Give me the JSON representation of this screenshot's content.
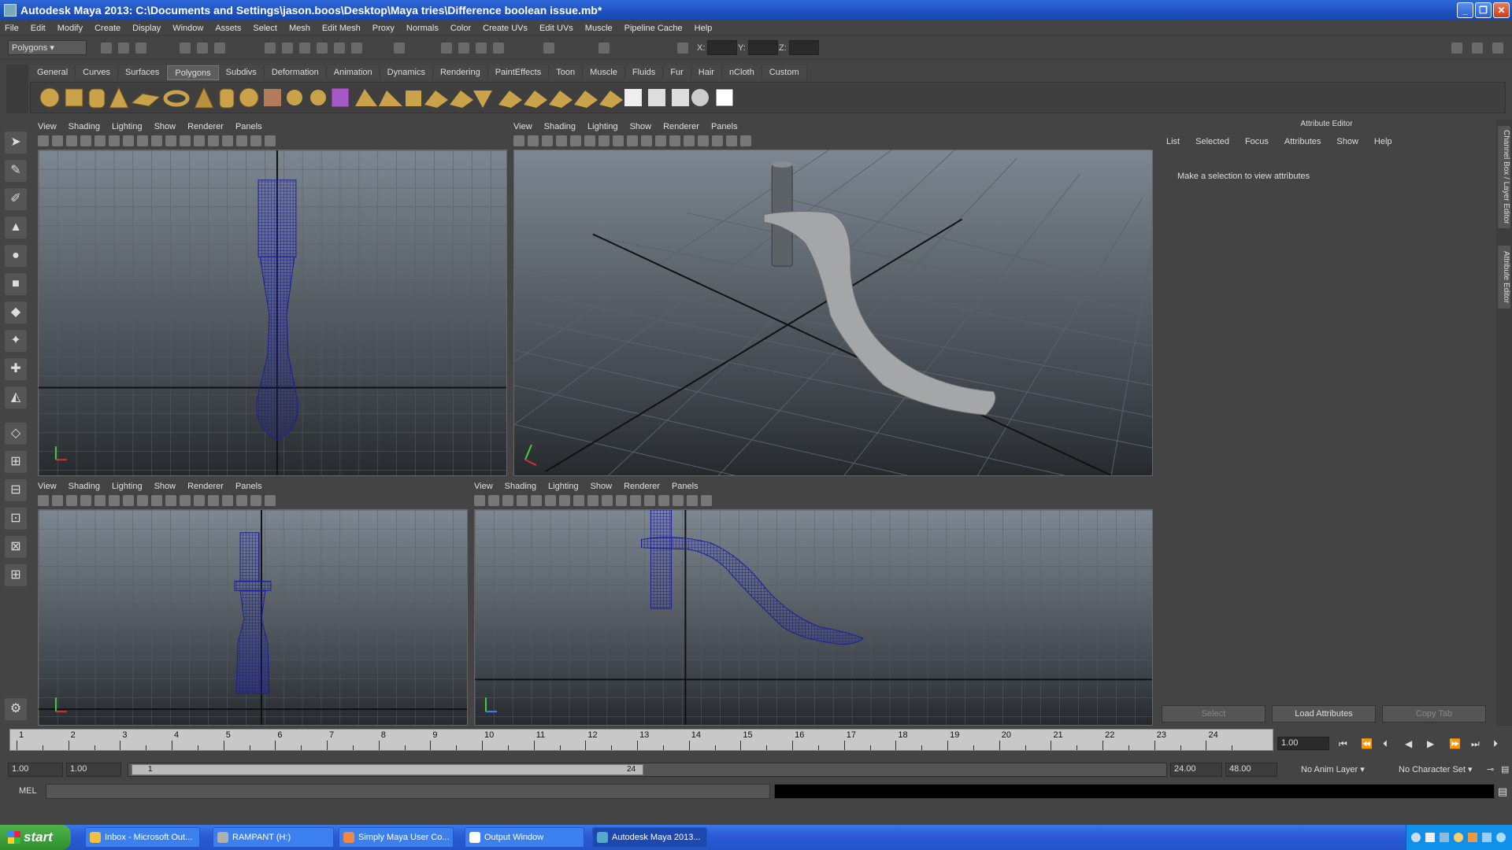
{
  "window": {
    "title": "Autodesk Maya 2013: C:\\Documents and Settings\\jason.boos\\Desktop\\Maya tries\\Difference boolean issue.mb*"
  },
  "menu": [
    "File",
    "Edit",
    "Modify",
    "Create",
    "Display",
    "Window",
    "Assets",
    "Select",
    "Mesh",
    "Edit Mesh",
    "Proxy",
    "Normals",
    "Color",
    "Create UVs",
    "Edit UVs",
    "Muscle",
    "Pipeline Cache",
    "Help"
  ],
  "status_line": {
    "mode": "Polygons",
    "x_label": "X:",
    "y_label": "Y:",
    "z_label": "Z:"
  },
  "shelf": {
    "tabs": [
      "General",
      "Curves",
      "Surfaces",
      "Polygons",
      "Subdivs",
      "Deformation",
      "Animation",
      "Dynamics",
      "Rendering",
      "PaintEffects",
      "Toon",
      "Muscle",
      "Fluids",
      "Fur",
      "Hair",
      "nCloth",
      "Custom"
    ],
    "active_tab": "Polygons"
  },
  "panel_menu": [
    "View",
    "Shading",
    "Lighting",
    "Show",
    "Renderer",
    "Panels"
  ],
  "viewports": {
    "top_left": {
      "camera": "side"
    },
    "top_right": {
      "camera": "persp"
    },
    "bottom_left": {
      "camera": "front"
    },
    "bottom_right": {
      "camera": "side"
    }
  },
  "attribute_editor": {
    "title": "Attribute Editor",
    "menu": [
      "List",
      "Selected",
      "Focus",
      "Attributes",
      "Show",
      "Help"
    ],
    "message": "Make a selection to view attributes",
    "buttons": {
      "select": "Select",
      "load": "Load Attributes",
      "copy": "Copy Tab"
    },
    "side_tabs": [
      "Channel Box / Layer Editor",
      "Attribute Editor"
    ]
  },
  "time_slider": {
    "ticks": [
      "1",
      "2",
      "3",
      "4",
      "5",
      "6",
      "7",
      "8",
      "9",
      "10",
      "11",
      "12",
      "13",
      "14",
      "15",
      "16",
      "17",
      "18",
      "19",
      "20",
      "21",
      "22",
      "23",
      "24"
    ],
    "current_frame": "1.00"
  },
  "range_slider": {
    "start": "1.00",
    "inner_start": "1.00",
    "handle_start": "1",
    "handle_end": "24",
    "end": "24.00",
    "max": "48.00",
    "anim_layer": "No Anim Layer",
    "character_set": "No Character Set"
  },
  "command_line": {
    "label": "MEL"
  },
  "taskbar": {
    "start": "start",
    "items": [
      {
        "label": "Inbox - Microsoft Out...",
        "color": "#f0c040"
      },
      {
        "label": "RAMPANT (H:)",
        "color": "#b0b0b0"
      },
      {
        "label": "Simply Maya User Co...",
        "color": "#e84"
      },
      {
        "label": "Output Window",
        "color": "#fff"
      },
      {
        "label": "Autodesk Maya 2013...",
        "color": "#5ac"
      }
    ]
  }
}
